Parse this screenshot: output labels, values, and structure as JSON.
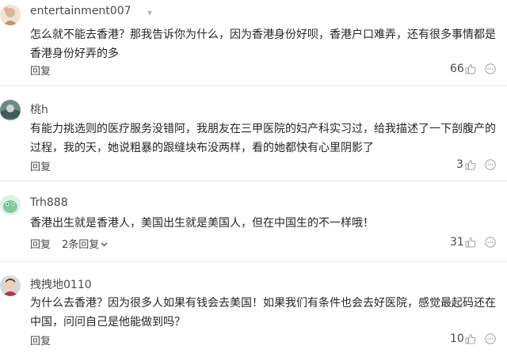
{
  "colors": {
    "text": "#262626",
    "meta": "#4a4a4a",
    "icon": "#a6a6a6",
    "divider": "#e9e9e9"
  },
  "comments": [
    {
      "username": "entertainment007",
      "text": "怎么就不能去香港？那我告诉你为什么，因为香港身份好呗，香港户口难弄，还有很多事情都是香港身份好弄的多",
      "reply_label": "回复",
      "likes": "66"
    },
    {
      "username": "桃h",
      "text": "有能力挑选则的医疗服务没错阿，我朋友在三甲医院的妇产科实习过，给我描述了一下剖腹产的过程，我的天，她说粗暴的跟缝块布没两样，看的她都快有心里阴影了",
      "reply_label": "回复",
      "likes": "3"
    },
    {
      "username": "Trh888",
      "text": "香港出生就是香港人，美国出生就是美国人，但在中国生的不一样哦！",
      "reply_label": "回复",
      "replies_label": "2条回复",
      "likes": "31"
    },
    {
      "username": "拽拽地0110",
      "text": "为什么去香港？因为很多人如果有钱会去美国！如果我们有条件也会去好医院，感觉最起码还在中国，问问自己是他能做到吗？",
      "reply_label": "回复",
      "likes": "10"
    }
  ],
  "icons": {
    "like": "thumbs-up-icon",
    "more": "more-dots-icon",
    "menu": "caret-down-icon"
  }
}
